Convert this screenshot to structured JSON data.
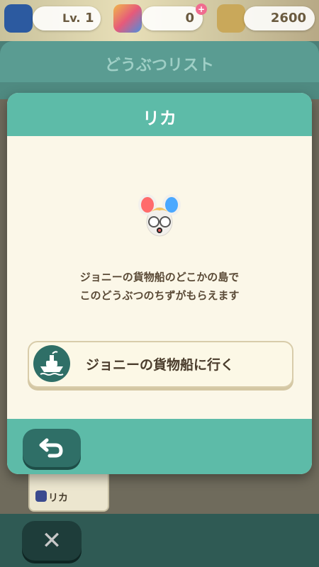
{
  "status_bar": {
    "level_label": "Lv.",
    "level_value": "1",
    "tickets_value": "0",
    "bells_value": "2600"
  },
  "panel": {
    "title": "どうぶつリスト"
  },
  "underlying_card": {
    "name": "リカ"
  },
  "modal": {
    "title": "リカ",
    "description_line1": "ジョニーの貨物船のどこかの島で",
    "description_line2": "このどうぶつのちずがもらえます",
    "action_label": "ジョニーの貨物船に行く"
  },
  "colors": {
    "header_teal": "#5dbba8",
    "body_cream": "#fbf7e8",
    "button_dark_teal": "#2f6f67"
  },
  "icons": {
    "close": "x-icon",
    "back": "return-arrow-icon",
    "ship": "ship-icon",
    "animal": "mouse-villager-icon"
  }
}
